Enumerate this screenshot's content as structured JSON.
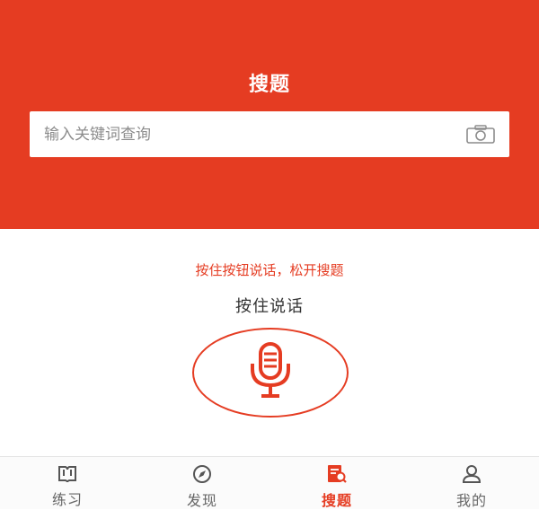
{
  "header": {
    "title": "搜题",
    "search": {
      "placeholder": "输入关键词查询",
      "value": ""
    },
    "camera_icon": "camera-icon"
  },
  "voice": {
    "hint": "按住按钮说话，松开搜题",
    "label": "按住说话",
    "mic_icon": "microphone-icon"
  },
  "tabbar": {
    "items": [
      {
        "label": "练习",
        "icon": "book-icon",
        "active": false
      },
      {
        "label": "发现",
        "icon": "compass-icon",
        "active": false
      },
      {
        "label": "搜题",
        "icon": "search-doc-icon",
        "active": true
      },
      {
        "label": "我的",
        "icon": "user-icon",
        "active": false
      }
    ]
  },
  "colors": {
    "brand": "#e53c22",
    "tab_inactive": "#666666",
    "background": "#ffffff"
  }
}
